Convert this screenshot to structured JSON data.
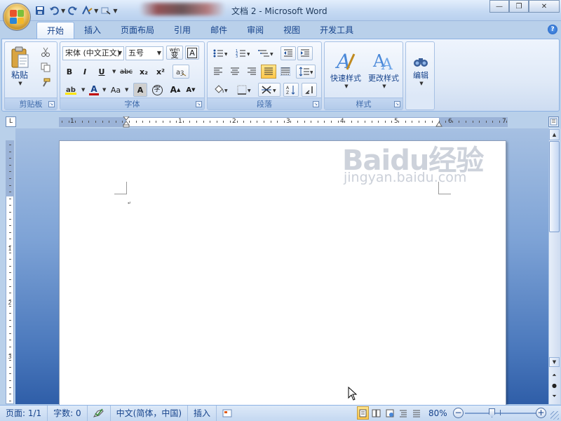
{
  "window": {
    "title": "文档 2 - Microsoft Word",
    "controls": {
      "minimize": "—",
      "restore": "❐",
      "close": "✕"
    }
  },
  "quick_access": {
    "save_icon": "floppy-icon",
    "undo_icon": "undo-icon",
    "redo_icon": "redo-icon"
  },
  "tabs": [
    {
      "label": "开始",
      "active": true
    },
    {
      "label": "插入"
    },
    {
      "label": "页面布局"
    },
    {
      "label": "引用"
    },
    {
      "label": "邮件"
    },
    {
      "label": "审阅"
    },
    {
      "label": "视图"
    },
    {
      "label": "开发工具"
    }
  ],
  "help": "?",
  "ribbon": {
    "clipboard": {
      "label": "剪贴板",
      "paste": "粘贴"
    },
    "font": {
      "label": "字体",
      "font_name": "宋体 (中文正文)",
      "font_size": "五号",
      "wen_label": "wén\n变",
      "bold": "B",
      "italic": "I",
      "underline": "U",
      "strike": "abc",
      "sub": "x₂",
      "sup": "x²",
      "change_case": "Aa",
      "char_shading": "A",
      "enclose": "字",
      "grow": "A",
      "shrink": "A",
      "font_color": "A"
    },
    "paragraph": {
      "label": "段落"
    },
    "styles": {
      "label": "样式",
      "quick_styles": "快速样式",
      "change_styles": "更改样式"
    },
    "editing": {
      "label": "编辑"
    }
  },
  "ruler": {
    "numbers": [
      "1",
      "1",
      "2",
      "3",
      "4",
      "5",
      "6",
      "7"
    ]
  },
  "vruler": {
    "numbers": [
      "1",
      "2",
      "3"
    ]
  },
  "watermark": {
    "brand": "Baidu经验",
    "url": "jingyan.baidu.com"
  },
  "status": {
    "page": "页面: 1/1",
    "words": "字数: 0",
    "language": "中文(简体，中国)",
    "mode": "插入",
    "zoom": "80%",
    "zoom_level_percent": 80
  },
  "colors": {
    "accent": "#15428b",
    "highlight": "#ffe500",
    "font_color_bar": "#c00000"
  }
}
